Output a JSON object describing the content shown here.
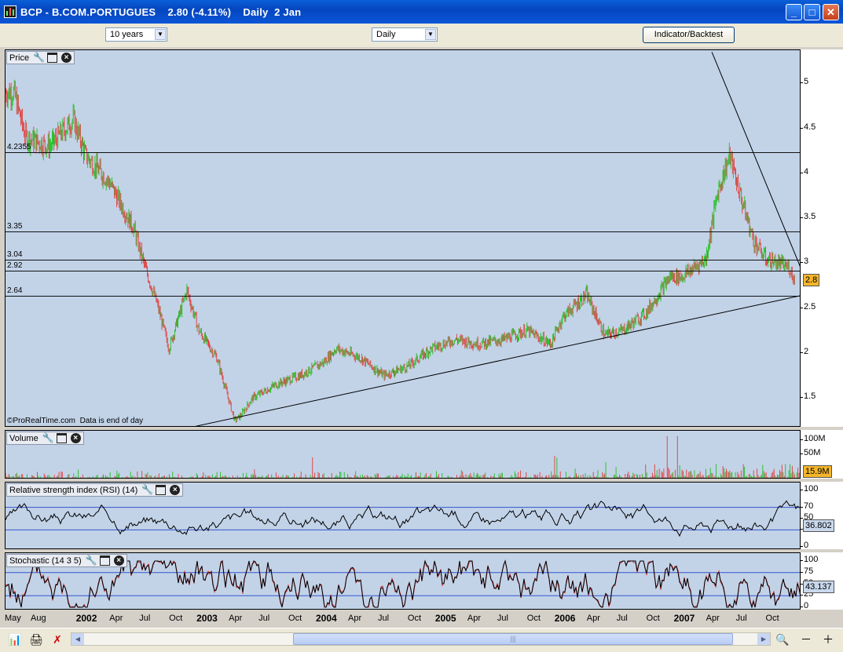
{
  "window": {
    "title": "BCP - B.COM.PORTUGUES    2.80 (-4.11%)    Daily  2 Jan",
    "minimize": "_",
    "maximize": "□",
    "close": "✕"
  },
  "toolbar": {
    "period": "10 years",
    "interval": "Daily",
    "indicator_button": "Indicator/Backtest"
  },
  "price_panel": {
    "title": "Price",
    "footnote": "©ProRealTime.com  Data is end of day",
    "axis_ticks": [
      "5",
      "4.5",
      "4",
      "3.5",
      "3",
      "2.5",
      "2",
      "1.5"
    ],
    "axis_values": [
      5,
      4.5,
      4,
      3.5,
      3,
      2.5,
      2,
      1.5
    ],
    "last_value": "2.8",
    "level_labels": [
      "4.2355",
      "3.35",
      "3.04",
      "2.92",
      "2.64"
    ],
    "levels": [
      4.2355,
      3.35,
      3.04,
      2.92,
      2.64
    ],
    "colors": {
      "up": "#2fc02f",
      "down": "#e04848",
      "background": "#c2d3e8"
    }
  },
  "volume_panel": {
    "title": "Volume",
    "axis_ticks": [
      "100M",
      "50M"
    ],
    "last_value": "15.9M"
  },
  "rsi_panel": {
    "title": "Relative strength index (RSI) (14)",
    "axis_ticks": [
      "100",
      "70",
      "50",
      "30",
      "0"
    ],
    "axis_values": [
      100,
      70,
      50,
      30,
      0
    ],
    "guides": [
      70,
      30
    ],
    "last_value": "36.802"
  },
  "stoch_panel": {
    "title": "Stochastic (14 3 5)",
    "axis_ticks": [
      "100",
      "75",
      "50",
      "25",
      "0"
    ],
    "axis_values": [
      100,
      75,
      50,
      25,
      0
    ],
    "guides": [
      75,
      25
    ],
    "last_value": "43.137"
  },
  "time_axis": [
    {
      "label": "May",
      "bold": false
    },
    {
      "label": "Aug",
      "bold": false
    },
    {
      "label": "2002",
      "bold": true
    },
    {
      "label": "Apr",
      "bold": false
    },
    {
      "label": "Jul",
      "bold": false
    },
    {
      "label": "Oct",
      "bold": false
    },
    {
      "label": "2003",
      "bold": true
    },
    {
      "label": "Apr",
      "bold": false
    },
    {
      "label": "Jul",
      "bold": false
    },
    {
      "label": "Oct",
      "bold": false
    },
    {
      "label": "2004",
      "bold": true
    },
    {
      "label": "Apr",
      "bold": false
    },
    {
      "label": "Jul",
      "bold": false
    },
    {
      "label": "Oct",
      "bold": false
    },
    {
      "label": "2005",
      "bold": true
    },
    {
      "label": "Apr",
      "bold": false
    },
    {
      "label": "Jul",
      "bold": false
    },
    {
      "label": "Oct",
      "bold": false
    },
    {
      "label": "2006",
      "bold": true
    },
    {
      "label": "Apr",
      "bold": false
    },
    {
      "label": "Jul",
      "bold": false
    },
    {
      "label": "Oct",
      "bold": false
    },
    {
      "label": "2007",
      "bold": true
    },
    {
      "label": "Apr",
      "bold": false
    },
    {
      "label": "Jul",
      "bold": false
    },
    {
      "label": "Oct",
      "bold": false
    }
  ],
  "chart_data": [
    {
      "type": "line",
      "title": "Price",
      "x": [
        2001.4,
        2001.5,
        2001.7,
        2001.9,
        2002.0,
        2002.2,
        2002.4,
        2002.5,
        2002.6,
        2002.7,
        2002.85,
        2002.95,
        2003.1,
        2003.25,
        2003.3,
        2003.4,
        2003.6,
        2003.8,
        2004.0,
        2004.1,
        2004.3,
        2004.5,
        2004.7,
        2004.9,
        2005.1,
        2005.3,
        2005.5,
        2005.7,
        2005.9,
        2006.0,
        2006.2,
        2006.35,
        2006.5,
        2006.7,
        2006.9,
        2007.0,
        2007.2,
        2007.3,
        2007.4,
        2007.5,
        2007.6,
        2007.7,
        2007.8,
        2007.9,
        2007.95
      ],
      "y": [
        4.9,
        4.4,
        4.3,
        4.6,
        4.2,
        3.9,
        3.4,
        2.95,
        2.55,
        2.05,
        2.7,
        2.25,
        1.95,
        1.25,
        1.3,
        1.5,
        1.65,
        1.75,
        1.9,
        2.05,
        1.95,
        1.75,
        1.85,
        2.05,
        2.15,
        2.1,
        2.15,
        2.25,
        2.1,
        2.4,
        2.65,
        2.2,
        2.25,
        2.45,
        2.85,
        2.85,
        3.05,
        3.8,
        4.2,
        3.7,
        3.25,
        3.05,
        3.0,
        2.95,
        2.8
      ],
      "ylim": [
        1.1,
        5.3
      ]
    },
    {
      "type": "bar",
      "title": "Volume",
      "values_note": "daily volume",
      "last": 15.9
    },
    {
      "type": "line",
      "title": "Relative strength index (RSI) (14)",
      "last": 36.802,
      "ylim": [
        0,
        100
      ]
    },
    {
      "type": "line",
      "title": "Stochastic (14 3 5)",
      "last": 43.137,
      "ylim": [
        0,
        100
      ]
    }
  ]
}
